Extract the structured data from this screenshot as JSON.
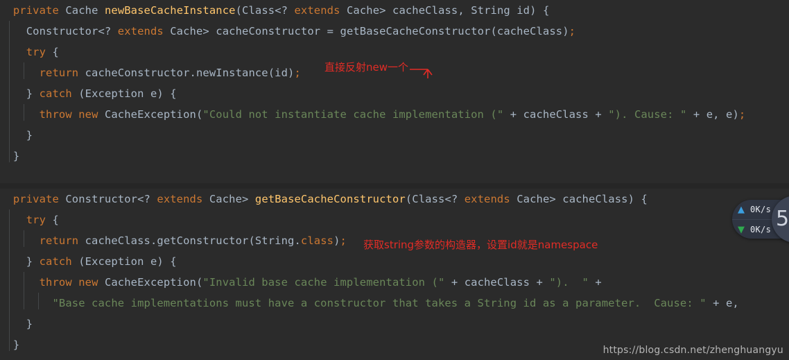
{
  "window": {
    "background_color": "#2b2b2b",
    "separator_color": "#262626"
  },
  "theme": {
    "keyword_color": "#cc7832",
    "type_color": "#a9b7c6",
    "method_color": "#ffc66d",
    "string_color": "#6a8759",
    "annotation_color": "#e32c26",
    "guide_color": "#4e5254"
  },
  "code_block_1": {
    "lines": [
      {
        "indent": 0,
        "tokens": [
          {
            "t": "private",
            "c": "kw"
          },
          {
            "t": " ",
            "c": "pun"
          },
          {
            "t": "Cache",
            "c": "typ"
          },
          {
            "t": " ",
            "c": "pun"
          },
          {
            "t": "newBaseCacheInstance",
            "c": "mth"
          },
          {
            "t": "(",
            "c": "pun"
          },
          {
            "t": "Class",
            "c": "typ"
          },
          {
            "t": "<? ",
            "c": "pun"
          },
          {
            "t": "extends",
            "c": "kw"
          },
          {
            "t": " ",
            "c": "pun"
          },
          {
            "t": "Cache",
            "c": "typ"
          },
          {
            "t": "> ",
            "c": "pun"
          },
          {
            "t": "cacheClass",
            "c": "var"
          },
          {
            "t": ", ",
            "c": "pun"
          },
          {
            "t": "String",
            "c": "typ"
          },
          {
            "t": " ",
            "c": "pun"
          },
          {
            "t": "id",
            "c": "var"
          },
          {
            "t": ") {",
            "c": "pun"
          }
        ]
      },
      {
        "indent": 1,
        "tokens": [
          {
            "t": "Constructor",
            "c": "typ"
          },
          {
            "t": "<? ",
            "c": "pun"
          },
          {
            "t": "extends",
            "c": "kw"
          },
          {
            "t": " ",
            "c": "pun"
          },
          {
            "t": "Cache",
            "c": "typ"
          },
          {
            "t": "> ",
            "c": "pun"
          },
          {
            "t": "cacheConstructor",
            "c": "var"
          },
          {
            "t": " = ",
            "c": "pun"
          },
          {
            "t": "getBaseCacheConstructor",
            "c": "var"
          },
          {
            "t": "(",
            "c": "pun"
          },
          {
            "t": "cacheClass",
            "c": "var"
          },
          {
            "t": ")",
            "c": "pun"
          },
          {
            "t": ";",
            "c": "semi"
          }
        ]
      },
      {
        "indent": 1,
        "tokens": [
          {
            "t": "try",
            "c": "kw"
          },
          {
            "t": " {",
            "c": "pun"
          }
        ]
      },
      {
        "indent": 2,
        "tokens": [
          {
            "t": "return",
            "c": "kw"
          },
          {
            "t": " ",
            "c": "pun"
          },
          {
            "t": "cacheConstructor",
            "c": "var"
          },
          {
            "t": ".",
            "c": "pun"
          },
          {
            "t": "newInstance",
            "c": "var"
          },
          {
            "t": "(",
            "c": "pun"
          },
          {
            "t": "id",
            "c": "var"
          },
          {
            "t": ")",
            "c": "pun"
          },
          {
            "t": ";",
            "c": "semi"
          }
        ]
      },
      {
        "indent": 1,
        "tokens": [
          {
            "t": "} ",
            "c": "pun"
          },
          {
            "t": "catch",
            "c": "kw"
          },
          {
            "t": " (",
            "c": "pun"
          },
          {
            "t": "Exception",
            "c": "typ"
          },
          {
            "t": " ",
            "c": "pun"
          },
          {
            "t": "e",
            "c": "var"
          },
          {
            "t": ") {",
            "c": "pun"
          }
        ]
      },
      {
        "indent": 2,
        "tokens": [
          {
            "t": "throw",
            "c": "kw"
          },
          {
            "t": " ",
            "c": "pun"
          },
          {
            "t": "new",
            "c": "kw"
          },
          {
            "t": " ",
            "c": "pun"
          },
          {
            "t": "CacheException",
            "c": "typ"
          },
          {
            "t": "(",
            "c": "pun"
          },
          {
            "t": "\"Could not instantiate cache implementation (\"",
            "c": "str"
          },
          {
            "t": " + ",
            "c": "pun"
          },
          {
            "t": "cacheClass",
            "c": "var"
          },
          {
            "t": " + ",
            "c": "pun"
          },
          {
            "t": "\"). Cause: \"",
            "c": "str"
          },
          {
            "t": " + ",
            "c": "pun"
          },
          {
            "t": "e",
            "c": "var"
          },
          {
            "t": ", ",
            "c": "pun"
          },
          {
            "t": "e",
            "c": "var"
          },
          {
            "t": ")",
            "c": "pun"
          },
          {
            "t": ";",
            "c": "semi"
          }
        ]
      },
      {
        "indent": 1,
        "tokens": [
          {
            "t": "}",
            "c": "pun"
          }
        ]
      },
      {
        "indent": 0,
        "tokens": [
          {
            "t": "}",
            "c": "pun"
          }
        ]
      }
    ]
  },
  "code_block_2": {
    "lines": [
      {
        "indent": 0,
        "tokens": [
          {
            "t": "private",
            "c": "kw"
          },
          {
            "t": " ",
            "c": "pun"
          },
          {
            "t": "Constructor",
            "c": "typ"
          },
          {
            "t": "<? ",
            "c": "pun"
          },
          {
            "t": "extends",
            "c": "kw"
          },
          {
            "t": " ",
            "c": "pun"
          },
          {
            "t": "Cache",
            "c": "typ"
          },
          {
            "t": "> ",
            "c": "pun"
          },
          {
            "t": "getBaseCacheConstructor",
            "c": "mth"
          },
          {
            "t": "(",
            "c": "pun"
          },
          {
            "t": "Class",
            "c": "typ"
          },
          {
            "t": "<? ",
            "c": "pun"
          },
          {
            "t": "extends",
            "c": "kw"
          },
          {
            "t": " ",
            "c": "pun"
          },
          {
            "t": "Cache",
            "c": "typ"
          },
          {
            "t": "> ",
            "c": "pun"
          },
          {
            "t": "cacheClass",
            "c": "var"
          },
          {
            "t": ") {",
            "c": "pun"
          }
        ]
      },
      {
        "indent": 1,
        "tokens": [
          {
            "t": "try",
            "c": "kw"
          },
          {
            "t": " {",
            "c": "pun"
          }
        ]
      },
      {
        "indent": 2,
        "tokens": [
          {
            "t": "return",
            "c": "kw"
          },
          {
            "t": " ",
            "c": "pun"
          },
          {
            "t": "cacheClass",
            "c": "var"
          },
          {
            "t": ".",
            "c": "pun"
          },
          {
            "t": "getConstructor",
            "c": "var"
          },
          {
            "t": "(",
            "c": "pun"
          },
          {
            "t": "String",
            "c": "typ"
          },
          {
            "t": ".",
            "c": "pun"
          },
          {
            "t": "class",
            "c": "kw"
          },
          {
            "t": ")",
            "c": "pun"
          },
          {
            "t": ";",
            "c": "semi"
          }
        ]
      },
      {
        "indent": 1,
        "tokens": [
          {
            "t": "} ",
            "c": "pun"
          },
          {
            "t": "catch",
            "c": "kw"
          },
          {
            "t": " (",
            "c": "pun"
          },
          {
            "t": "Exception",
            "c": "typ"
          },
          {
            "t": " ",
            "c": "pun"
          },
          {
            "t": "e",
            "c": "var"
          },
          {
            "t": ") {",
            "c": "pun"
          }
        ]
      },
      {
        "indent": 2,
        "tokens": [
          {
            "t": "throw",
            "c": "kw"
          },
          {
            "t": " ",
            "c": "pun"
          },
          {
            "t": "new",
            "c": "kw"
          },
          {
            "t": " ",
            "c": "pun"
          },
          {
            "t": "CacheException",
            "c": "typ"
          },
          {
            "t": "(",
            "c": "pun"
          },
          {
            "t": "\"Invalid base cache implementation (\"",
            "c": "str"
          },
          {
            "t": " + ",
            "c": "pun"
          },
          {
            "t": "cacheClass",
            "c": "var"
          },
          {
            "t": " + ",
            "c": "pun"
          },
          {
            "t": "\").  \"",
            "c": "str"
          },
          {
            "t": " +",
            "c": "pun"
          }
        ]
      },
      {
        "indent": 3,
        "tokens": [
          {
            "t": "\"Base cache implementations must have a constructor that takes a String id as a parameter.  Cause: \"",
            "c": "str"
          },
          {
            "t": " + ",
            "c": "pun"
          },
          {
            "t": "e",
            "c": "var"
          },
          {
            "t": ",",
            "c": "pun"
          }
        ]
      },
      {
        "indent": 1,
        "tokens": [
          {
            "t": "}",
            "c": "pun"
          }
        ]
      },
      {
        "indent": 0,
        "tokens": [
          {
            "t": "}",
            "c": "pun"
          }
        ]
      }
    ]
  },
  "annotations": [
    {
      "id": "annot-1",
      "text": "直接反射new一个"
    },
    {
      "id": "annot-2",
      "text": "获取string参数的构造器，设置id就是namespace"
    }
  ],
  "net_widget": {
    "upload": {
      "icon": "arrow-up-icon",
      "glyph": "▲",
      "value": "0K/s"
    },
    "download": {
      "icon": "arrow-down-icon",
      "glyph": "▼",
      "value": "0K/s"
    },
    "badge_text": "5"
  },
  "watermark": {
    "text": "https://blog.csdn.net/zhenghuangyu"
  }
}
